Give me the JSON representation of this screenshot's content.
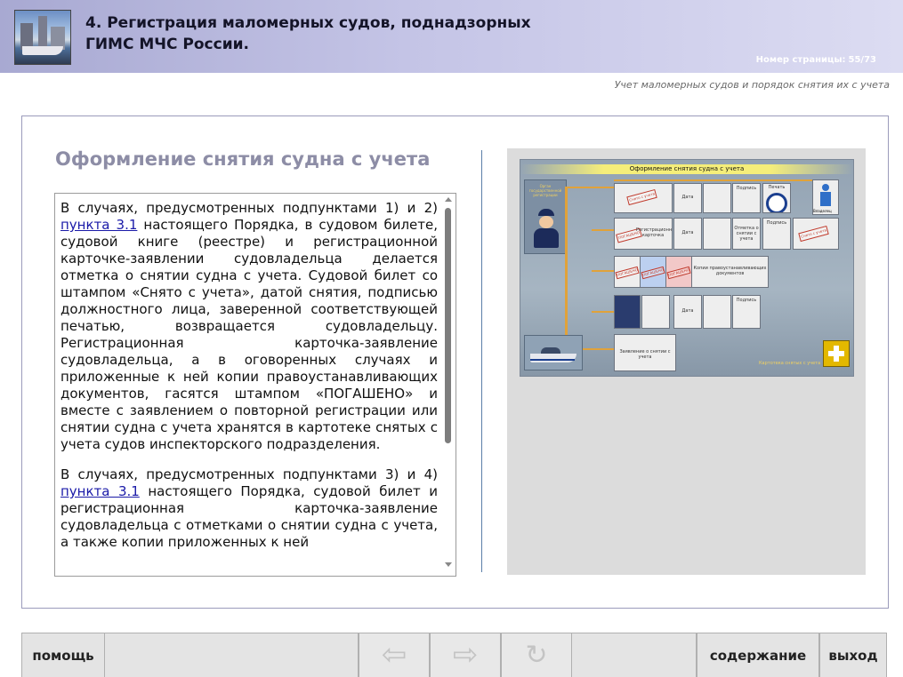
{
  "header": {
    "title": "4. Регистрация маломерных судов, поднадзорных ГИМС МЧС России.",
    "page_label": "Номер страницы:",
    "page_number": "55/73",
    "subtitle": "Учет маломерных судов и порядок снятия их с учета"
  },
  "main": {
    "section_title": "Оформление снятия судна с учета",
    "paragraphs": [
      {
        "before": "В случаях, предусмотренных подпунктами 1) и 2) ",
        "link": "пункта 3.1",
        "after": " настоящего Порядка, в судовом билете, судовой книге (реестре) и регистрационной карточке-заявлении судовладельца делается отметка о снятии судна с учета. Судовой билет со штампом «Снято с учета», датой снятия, подписью должностного лица, заверенной соответствующей печатью, возвращается судовладельцу. Регистрационная карточка-заявление судовладельца, а в оговоренных случаях и приложенные к ней копии правоустанавливающих документов, гасятся штампом «ПОГАШЕНО» и вместе с заявлением о повторной регистрации или снятии судна с учета хранятся в картотеке снятых с учета судов инспекторского подразделения."
      },
      {
        "before": "В случаях, предусмотренных подпунктами 3) и 4) ",
        "link": "пункта 3.1",
        "after": " настоящего Порядка, судовой билет и регистрационная карточка-заявление судовладельца с отметками о снятии судна с учета, а также копии приложенных к ней"
      }
    ]
  },
  "diagram": {
    "title": "Оформление снятия судна с учета",
    "officer_label": "Орган государственной регистрации",
    "owner_label": "Владелец",
    "date": "Дата",
    "signature": "Подпись",
    "seal": "Печать",
    "reg_card": "Регистрационная карточка",
    "removal_mark": "Отметка о снятии с учета",
    "docs": "Копии правоустанавливающих документов",
    "application": "Заявление о снятии с учета",
    "cancelled": "ПОГАШЕНО",
    "removed": "Снято с учета",
    "kartoteka": "Картотека снятых с учета"
  },
  "nav": {
    "help": "помощь",
    "contents": "содержание",
    "exit": "выход"
  }
}
